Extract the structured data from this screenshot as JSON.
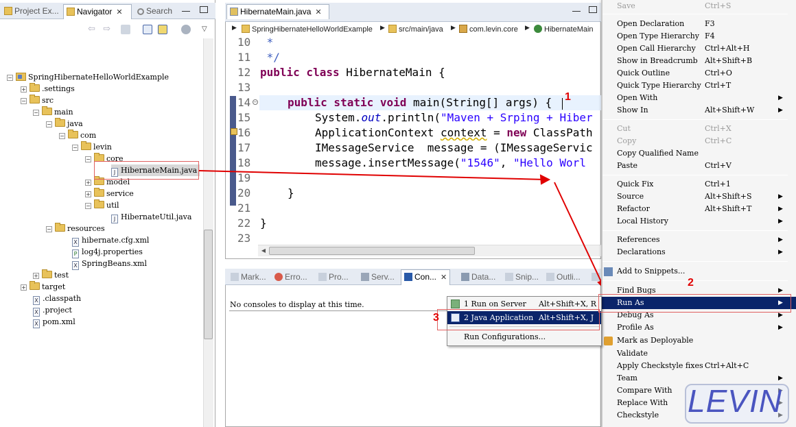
{
  "left_view": {
    "tabs": [
      {
        "label": "Project Ex..."
      },
      {
        "label": "Navigator",
        "close": "✕"
      },
      {
        "label": "Search"
      }
    ],
    "tree": [
      {
        "label": "SpringHibernateHelloWorldExample"
      },
      {
        "label": ".settings"
      },
      {
        "label": "src"
      },
      {
        "label": "main"
      },
      {
        "label": "java"
      },
      {
        "label": "com"
      },
      {
        "label": "levin"
      },
      {
        "label": "core"
      },
      {
        "label": "HibernateMain.java",
        "icon": "J"
      },
      {
        "label": "model"
      },
      {
        "label": "service"
      },
      {
        "label": "util"
      },
      {
        "label": "HibernateUtil.java",
        "icon": "J"
      },
      {
        "label": "resources"
      },
      {
        "label": "hibernate.cfg.xml",
        "icon": "X"
      },
      {
        "label": "log4j.properties",
        "icon": "P"
      },
      {
        "label": "SpringBeans.xml",
        "icon": "X"
      },
      {
        "label": "test"
      },
      {
        "label": "target"
      },
      {
        "label": ".classpath",
        "icon": "X"
      },
      {
        "label": ".project",
        "icon": "X"
      },
      {
        "label": "pom.xml",
        "icon": "X"
      }
    ]
  },
  "editor": {
    "tab": {
      "label": "HibernateMain.java",
      "close": "✕"
    },
    "breadcrumb": [
      "SpringHibernateHelloWorldExample",
      "src/main/java",
      "com.levin.core",
      "HibernateMain"
    ],
    "line_numbers": [
      "10",
      "11",
      "12",
      "13",
      "14",
      "15",
      "16",
      "17",
      "18",
      "19",
      "20",
      "21",
      "22",
      "23"
    ],
    "code": {
      "l10": " *",
      "l11": " */",
      "l12_kw": "public class",
      "l12_rest": " HibernateMain {",
      "l14_kw": "public static void",
      "l14_rest": " main(String[] args) {",
      "l15_a": "System.",
      "l15_b": "out",
      "l15_c": ".println(",
      "l15_d": "\"Maven + Srping + Hiber",
      "l16_a": "ApplicationContext ",
      "l16_b": "context",
      "l16_c": " = ",
      "l16_kw": "new",
      "l16_d": " ClassPath",
      "l17": "IMessageService  message = (IMessageServic",
      "l18_a": "message.insertMessage(",
      "l18_b": "\"1546\"",
      "l18_c": ", ",
      "l18_d": "\"Hello Worl",
      "l20": "}",
      "l22": "}"
    }
  },
  "bottom_view": {
    "tabs": [
      "Mark...",
      "Erro...",
      "Pro...",
      "Serv...",
      "Con...",
      "Data...",
      "Snip...",
      "Outli..."
    ],
    "active_tab_close": "✕",
    "message": "No consoles to display at this time."
  },
  "context_menu": {
    "items": [
      {
        "label": "Save",
        "accel": "Ctrl+S",
        "disabled": true
      },
      {
        "label": "Open Declaration",
        "accel": "F3"
      },
      {
        "label": "Open Type Hierarchy",
        "accel": "F4"
      },
      {
        "label": "Open Call Hierarchy",
        "accel": "Ctrl+Alt+H"
      },
      {
        "label": "Show in Breadcrumb",
        "accel": "Alt+Shift+B"
      },
      {
        "label": "Quick Outline",
        "accel": "Ctrl+O"
      },
      {
        "label": "Quick Type Hierarchy",
        "accel": "Ctrl+T"
      },
      {
        "label": "Open With",
        "accel": ""
      },
      {
        "label": "Show In",
        "accel": "Alt+Shift+W"
      },
      {
        "label": "Cut",
        "accel": "Ctrl+X",
        "disabled": true
      },
      {
        "label": "Copy",
        "accel": "Ctrl+C",
        "disabled": true
      },
      {
        "label": "Copy Qualified Name",
        "accel": ""
      },
      {
        "label": "Paste",
        "accel": "Ctrl+V"
      },
      {
        "label": "Quick Fix",
        "accel": "Ctrl+1"
      },
      {
        "label": "Source",
        "accel": "Alt+Shift+S"
      },
      {
        "label": "Refactor",
        "accel": "Alt+Shift+T"
      },
      {
        "label": "Local History",
        "accel": ""
      },
      {
        "label": "References",
        "accel": ""
      },
      {
        "label": "Declarations",
        "accel": ""
      },
      {
        "label": "Add to Snippets...",
        "accel": ""
      },
      {
        "label": "Find Bugs",
        "accel": ""
      },
      {
        "label": "Run As",
        "accel": ""
      },
      {
        "label": "Debug As",
        "accel": ""
      },
      {
        "label": "Profile As",
        "accel": ""
      },
      {
        "label": "Mark as Deployable",
        "accel": ""
      },
      {
        "label": "Validate",
        "accel": ""
      },
      {
        "label": "Apply Checkstyle fixes",
        "accel": "Ctrl+Alt+C"
      },
      {
        "label": "Team",
        "accel": ""
      },
      {
        "label": "Compare With",
        "accel": ""
      },
      {
        "label": "Replace With",
        "accel": ""
      },
      {
        "label": "Checkstyle",
        "accel": ""
      }
    ],
    "submenu_arrow": "▶"
  },
  "run_as_submenu": {
    "items": [
      {
        "label": "1 Run on Server",
        "accel": "Alt+Shift+X, R"
      },
      {
        "label": "2 Java Application",
        "accel": "Alt+Shift+X, J"
      },
      {
        "label": "Run Configurations..."
      }
    ]
  },
  "annotations": {
    "step1": "1",
    "step2": "2",
    "step3": "3",
    "color": "#e00000"
  },
  "watermark": "LEVIN"
}
